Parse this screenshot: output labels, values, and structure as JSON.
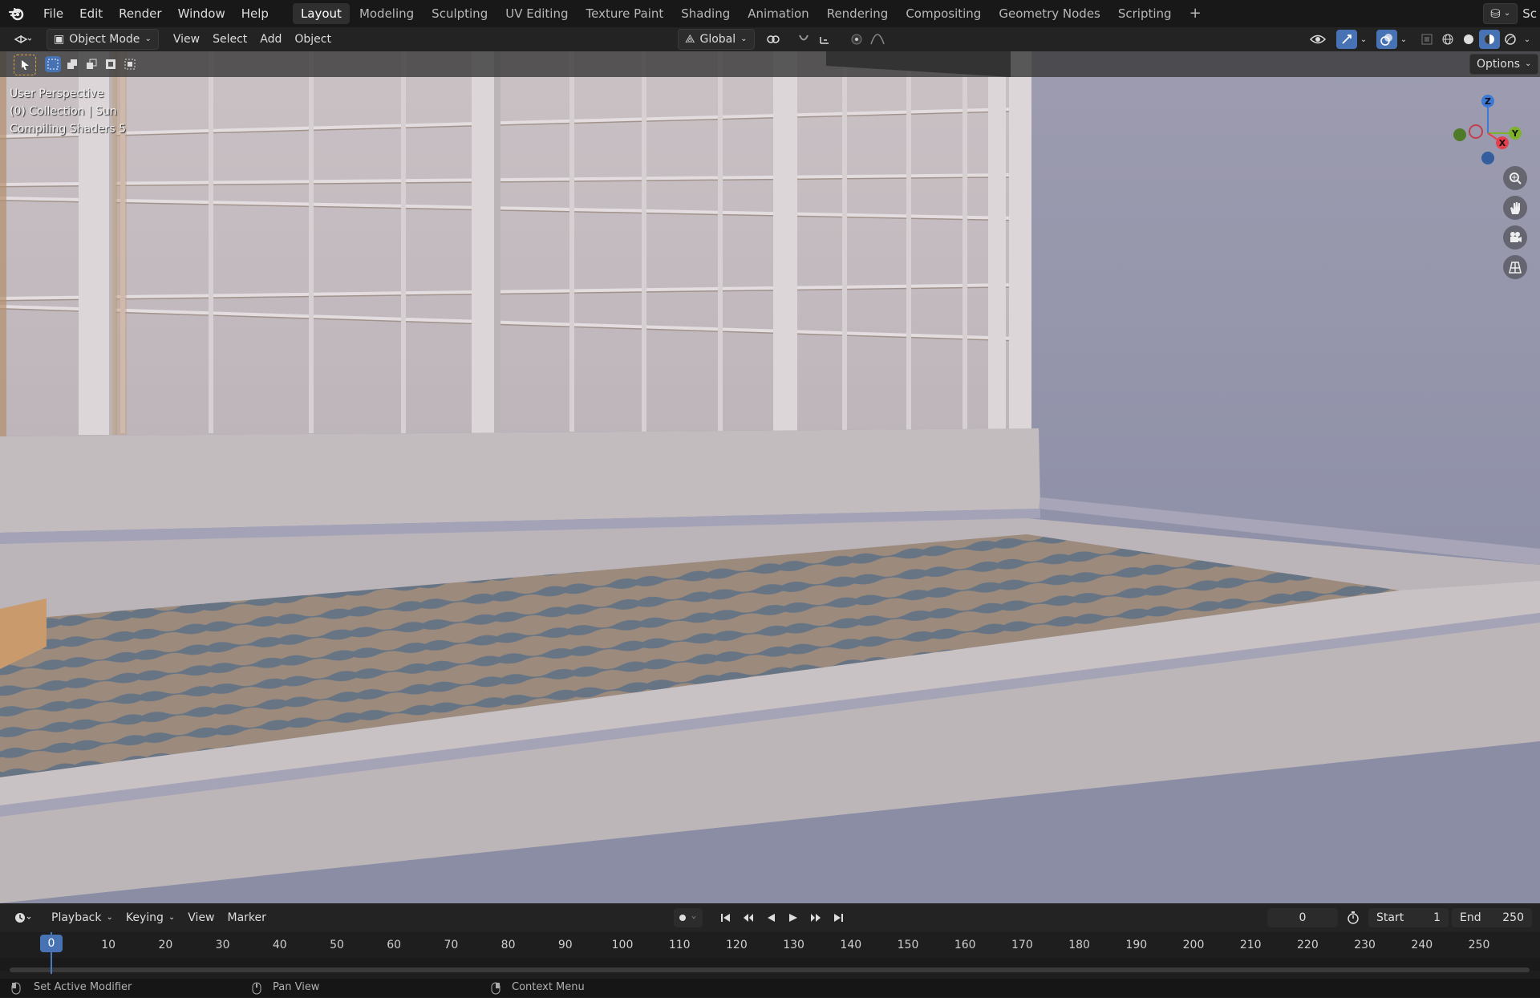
{
  "menu": [
    "File",
    "Edit",
    "Render",
    "Window",
    "Help"
  ],
  "workspaces": [
    {
      "label": "Layout",
      "active": true
    },
    {
      "label": "Modeling",
      "active": false
    },
    {
      "label": "Sculpting",
      "active": false
    },
    {
      "label": "UV Editing",
      "active": false
    },
    {
      "label": "Texture Paint",
      "active": false
    },
    {
      "label": "Shading",
      "active": false
    },
    {
      "label": "Animation",
      "active": false
    },
    {
      "label": "Rendering",
      "active": false
    },
    {
      "label": "Compositing",
      "active": false
    },
    {
      "label": "Geometry Nodes",
      "active": false
    },
    {
      "label": "Scripting",
      "active": false
    }
  ],
  "add_workspace": "+",
  "scene_label": "Sc",
  "header": {
    "mode": "Object Mode",
    "menu": [
      "View",
      "Select",
      "Add",
      "Object"
    ],
    "orientation": "Global"
  },
  "options_label": "Options",
  "overlay": {
    "line1": "User Perspective",
    "line2": "(0) Collection | Sun",
    "line3": "Compiling Shaders 5"
  },
  "gizmo": {
    "z": "Z",
    "x": "X",
    "y": "Y",
    "colors": {
      "x": "#e5404c",
      "y": "#7eb22b",
      "z": "#3b79d6"
    }
  },
  "timeline": {
    "menu": [
      "Playback",
      "Keying",
      "View",
      "Marker"
    ],
    "current_frame": "0",
    "start_label": "Start",
    "start_value": "1",
    "end_label": "End",
    "end_value": "250",
    "ticks": [
      "0",
      "10",
      "20",
      "30",
      "40",
      "50",
      "60",
      "70",
      "80",
      "90",
      "100",
      "110",
      "120",
      "130",
      "140",
      "150",
      "160",
      "170",
      "180",
      "190",
      "200",
      "210",
      "220",
      "230",
      "240",
      "250"
    ]
  },
  "status": {
    "left": "Set Active Modifier",
    "middle": "Pan View",
    "right": "Context Menu"
  },
  "colors": {
    "accent": "#4772b3",
    "wall": "#b9b3b8",
    "sky": "#8a8ea4"
  }
}
